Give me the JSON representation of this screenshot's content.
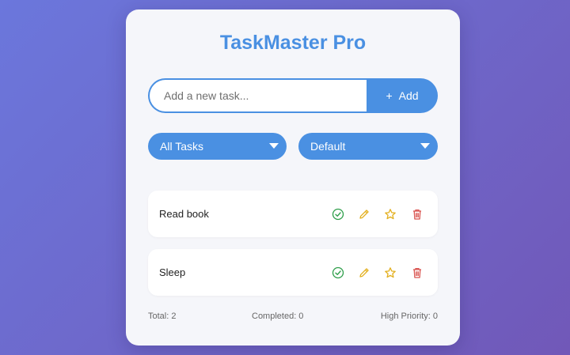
{
  "app": {
    "title": "TaskMaster Pro"
  },
  "add_task": {
    "placeholder": "Add a new task...",
    "value": "",
    "button_icon": "+",
    "button_label": "Add"
  },
  "filters": {
    "status_selected": "All Tasks",
    "sort_selected": "Default"
  },
  "tasks": [
    {
      "text": "Read book",
      "actions": [
        "check-circle-icon",
        "pencil-icon",
        "star-icon",
        "trash-icon"
      ]
    },
    {
      "text": "Sleep",
      "actions": [
        "check-circle-icon",
        "pencil-icon",
        "star-icon",
        "trash-icon"
      ]
    }
  ],
  "stats": {
    "total": "Total: 2",
    "completed": "Completed: 0",
    "high_priority": "High Priority: 0"
  },
  "colors": {
    "accent": "#4a90e2",
    "complete": "#2e9e4a",
    "edit": "#e3b020",
    "star": "#e3b020",
    "delete": "#d9534f"
  }
}
